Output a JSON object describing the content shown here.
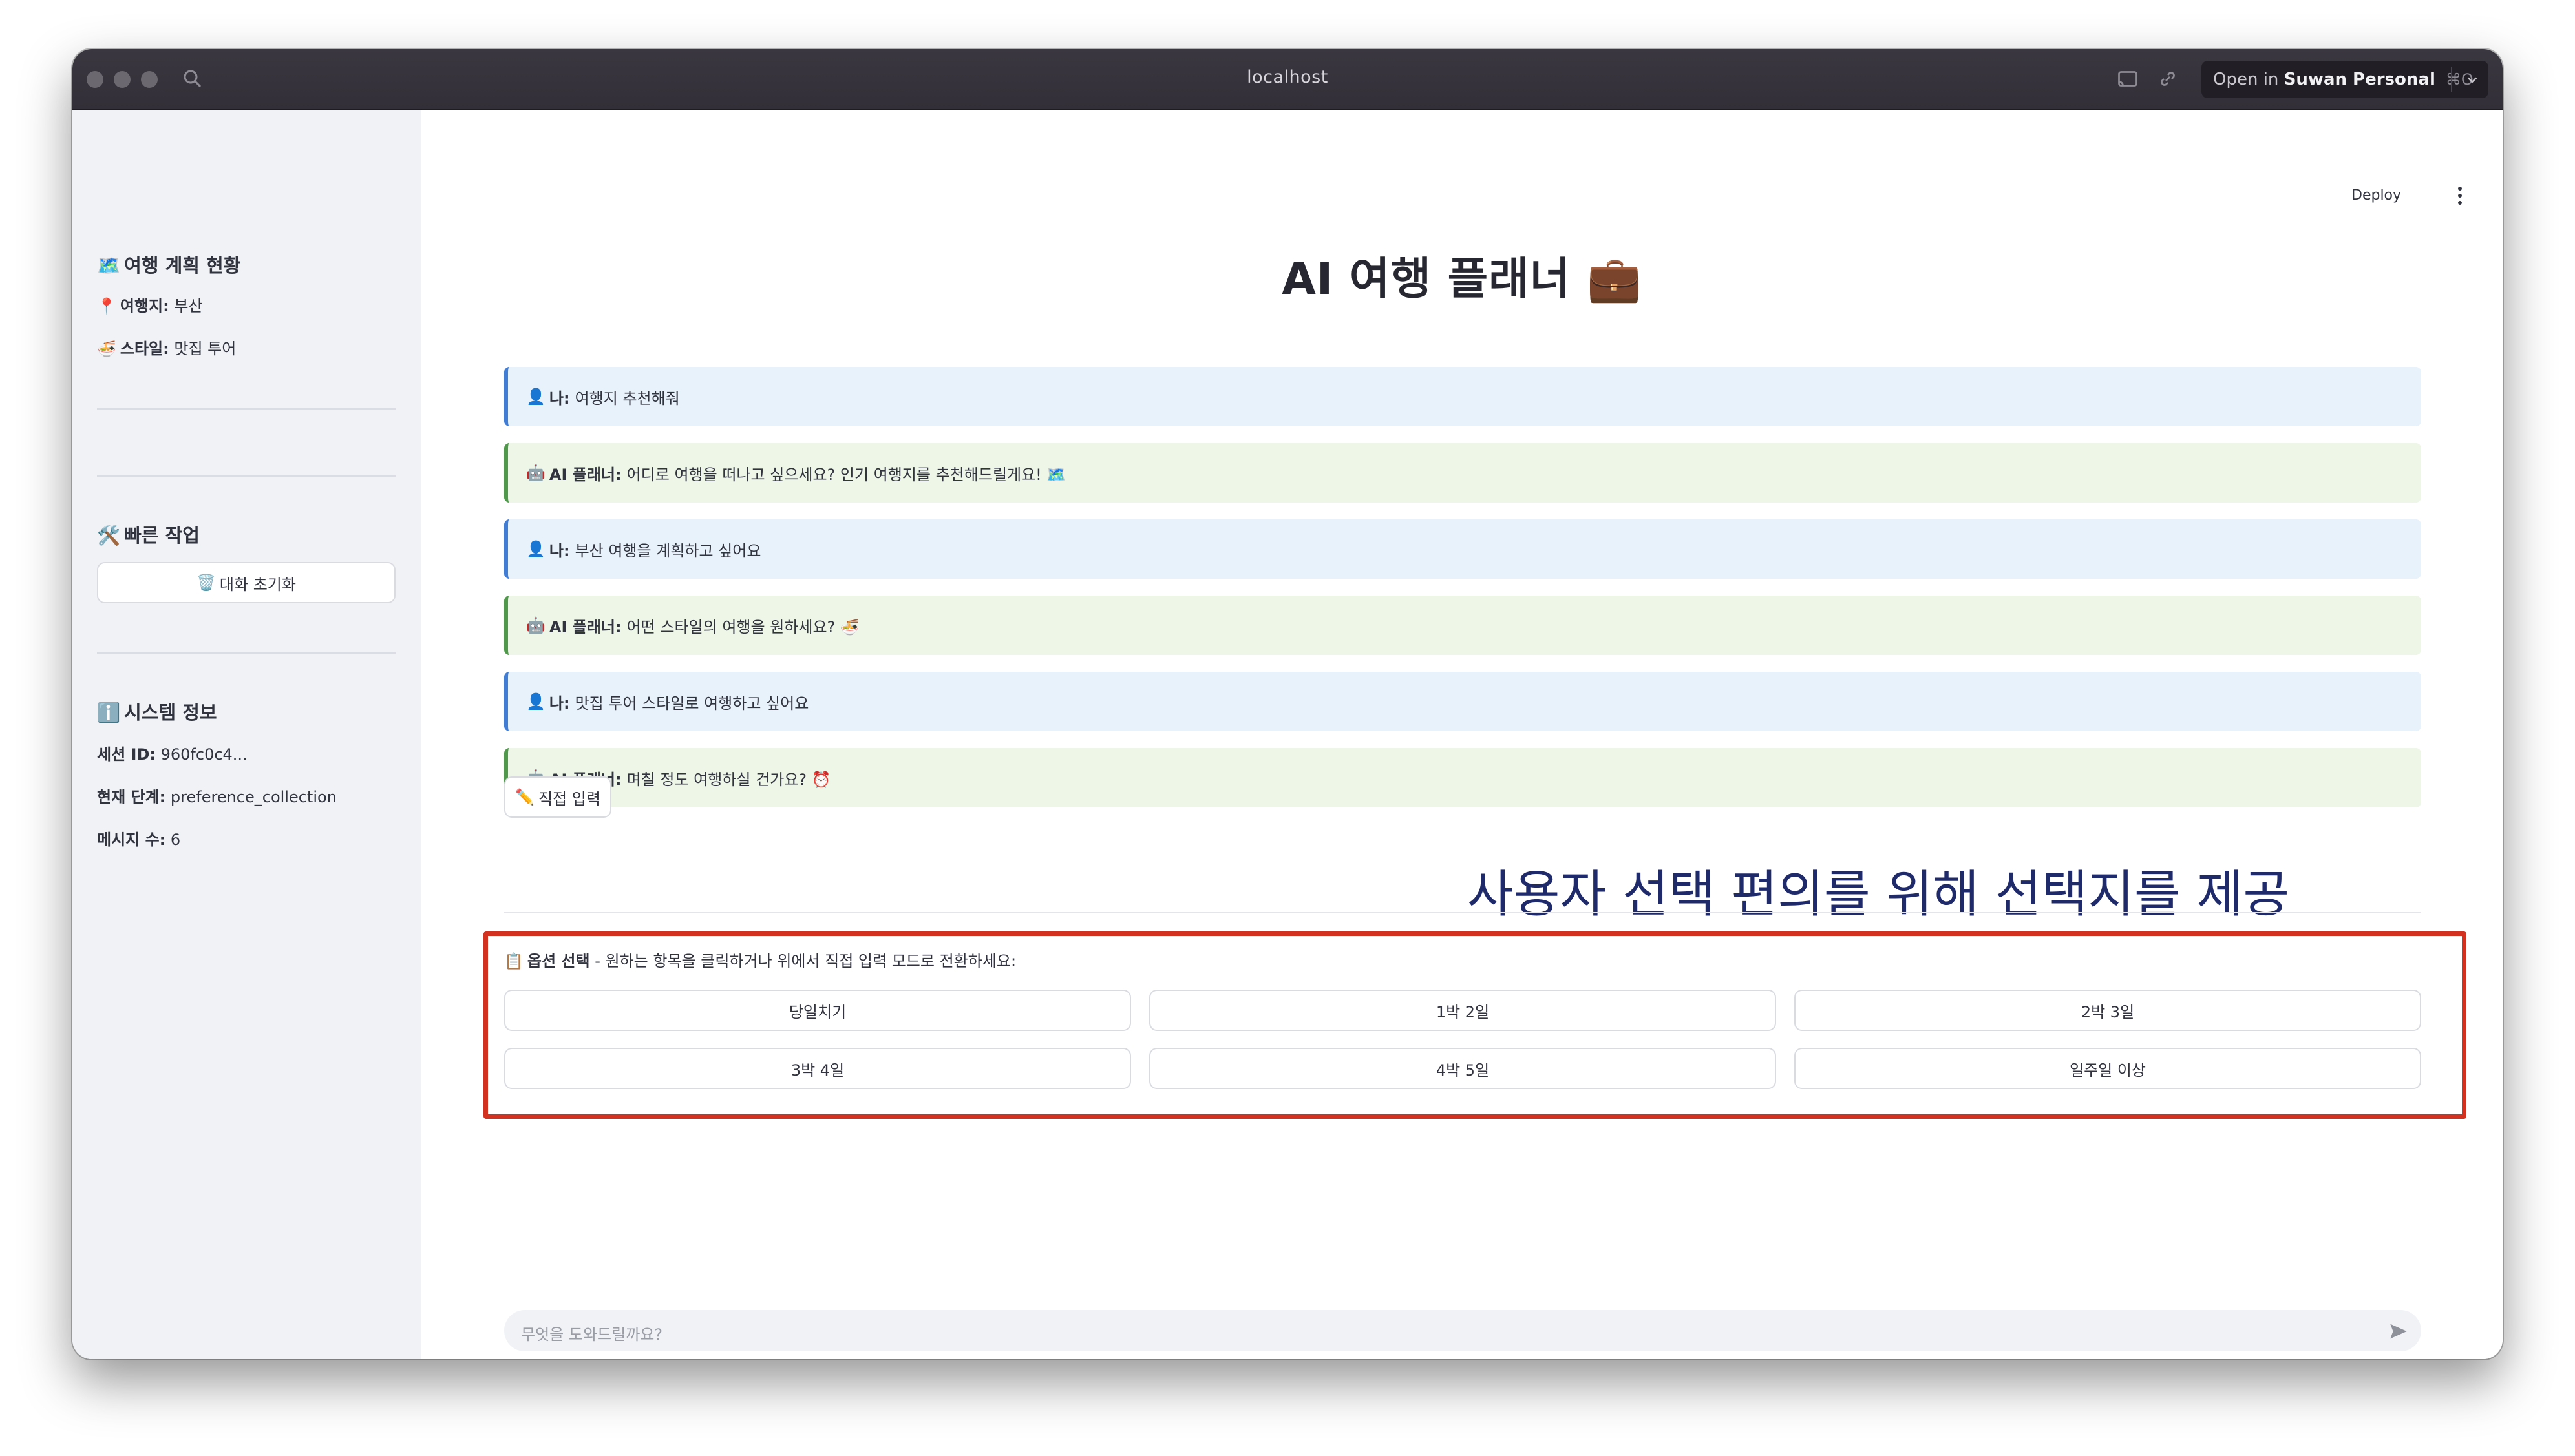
{
  "browser": {
    "url": "localhost",
    "open_in_prefix": "Open in ",
    "open_in_name": "Suwan Personal",
    "open_in_shortcut": "⌘O"
  },
  "sidebar": {
    "status_heading": "여행 계획 현황",
    "status_icon": "🗺️",
    "destination_icon": "📍",
    "destination_label": "여행지:",
    "destination_value": "부산",
    "style_icon": "🍜",
    "style_label": "스타일:",
    "style_value": "맛집 투어",
    "quick_heading": "빠른 작업",
    "quick_icon": "🛠️",
    "reset_icon": "🗑️",
    "reset_label": "대화 초기화",
    "system_heading": "시스템 정보",
    "system_icon": "ℹ️",
    "session_label": "세션 ID:",
    "session_value": "960fc0c4...",
    "stage_label": "현재 단계:",
    "stage_value": "preference_collection",
    "msgcount_label": "메시지 수:",
    "msgcount_value": "6"
  },
  "header": {
    "deploy_label": "Deploy"
  },
  "main": {
    "title": "AI 여행 플래너 💼",
    "messages": [
      {
        "icon": "👤",
        "speaker": "나:",
        "text": "여행지 추천해줘"
      },
      {
        "icon": "🤖",
        "speaker": "AI 플래너:",
        "text": "어디로 여행을 떠나고 싶으세요? 인기 여행지를 추천해드릴게요! 🗺️"
      },
      {
        "icon": "👤",
        "speaker": "나:",
        "text": "부산 여행을 계획하고 싶어요"
      },
      {
        "icon": "🤖",
        "speaker": "AI 플래너:",
        "text": "어떤 스타일의 여행을 원하세요? 🍜"
      },
      {
        "icon": "👤",
        "speaker": "나:",
        "text": "맛집 투어 스타일로 여행하고 싶어요"
      },
      {
        "icon": "🤖",
        "speaker": "AI 플래너:",
        "text": "며칠 정도 여행하실 건가요? ⏰"
      }
    ],
    "direct_input_icon": "✏️",
    "direct_input_label": "직접 입력",
    "annotation": "사용자 선택 편의를 위해 선택지를 제공",
    "options_icon": "📋",
    "options_title": "옵션 선택",
    "options_hint": " - 원하는 항목을 클릭하거나 위에서 직접 입력 모드로 전환하세요:",
    "options": [
      "당일치기",
      "1박 2일",
      "2박 3일",
      "3박 4일",
      "4박 5일",
      "일주일 이상"
    ],
    "chat_placeholder": "무엇을 도와드릴까요?"
  },
  "colors": {
    "user_bubble": "#e8f2fb",
    "ai_bubble": "#eef6e8",
    "highlight_border": "#d2321f",
    "annotation_text": "#1f2a6b"
  }
}
